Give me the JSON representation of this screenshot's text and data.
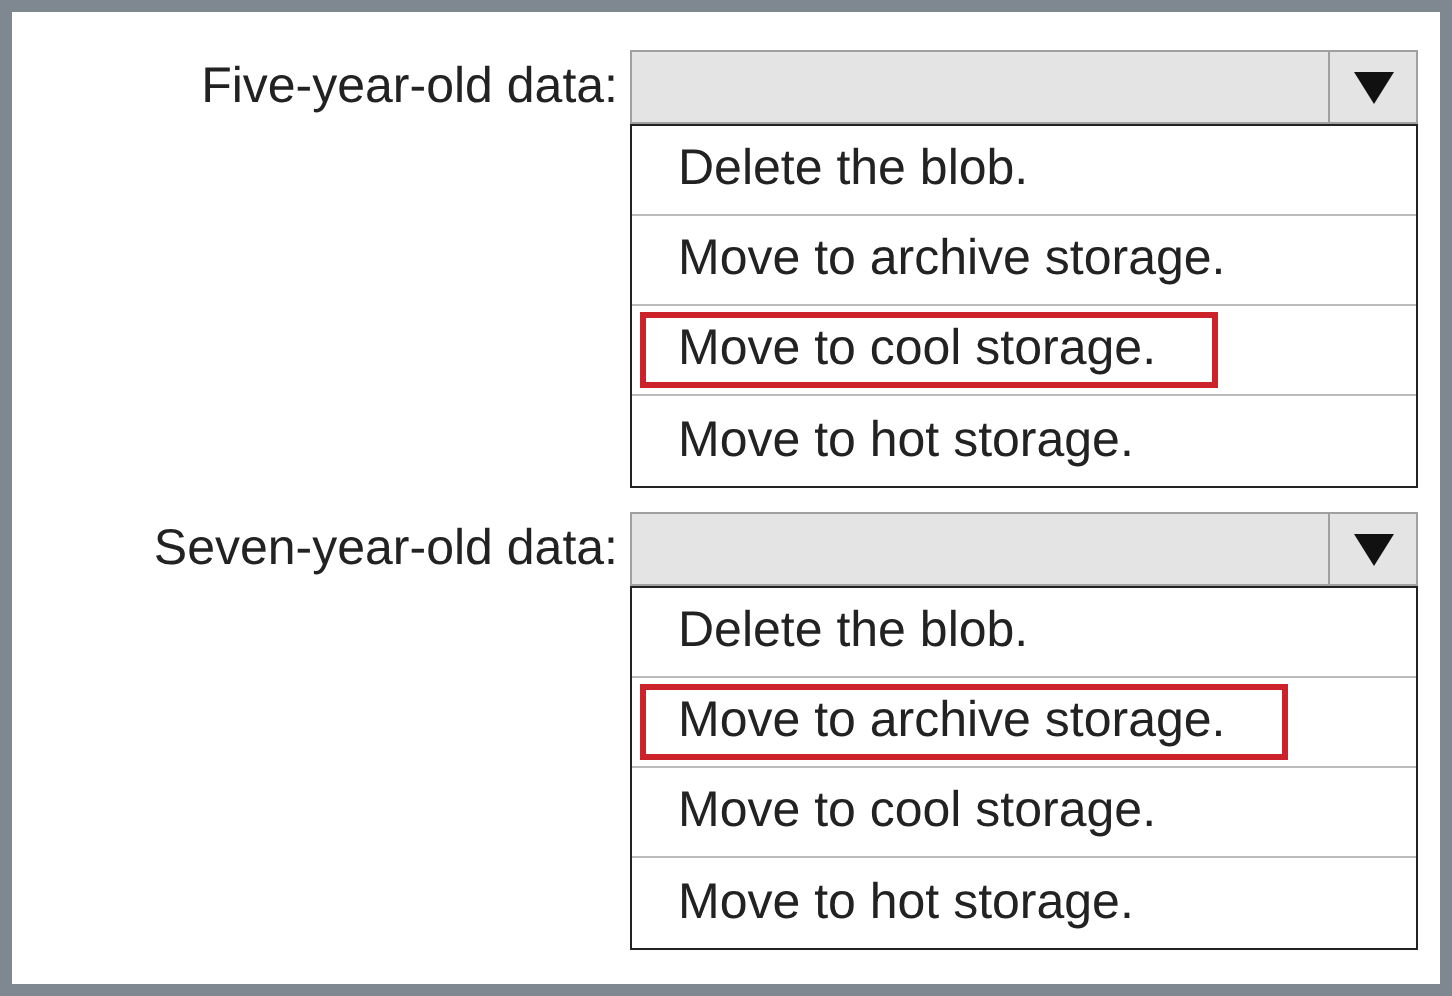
{
  "questions": [
    {
      "label": "Five-year-old data:",
      "options": [
        {
          "text": "Delete the blob.",
          "selected": false
        },
        {
          "text": "Move to archive storage.",
          "selected": false
        },
        {
          "text": "Move to cool storage.",
          "selected": true
        },
        {
          "text": "Move to hot storage.",
          "selected": false
        }
      ]
    },
    {
      "label": "Seven-year-old data:",
      "options": [
        {
          "text": "Delete the blob.",
          "selected": false
        },
        {
          "text": "Move to archive storage.",
          "selected": true
        },
        {
          "text": "Move to cool storage.",
          "selected": false
        },
        {
          "text": "Move to hot storage.",
          "selected": false
        }
      ]
    }
  ]
}
